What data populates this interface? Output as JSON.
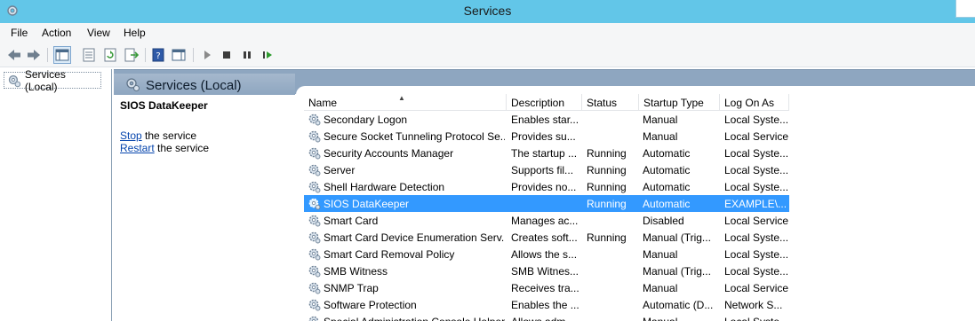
{
  "window": {
    "title": "Services",
    "app_icon": "gear-icon"
  },
  "menu": {
    "file": "File",
    "action": "Action",
    "view": "View",
    "help": "Help"
  },
  "toolbar": {
    "buttons": [
      "back-arrow-icon",
      "forward-arrow-icon",
      "show-hide-tree-icon",
      "properties-icon",
      "refresh-icon",
      "export-list-icon",
      "help-icon",
      "show-action-pane-icon",
      "play-icon",
      "stop-icon",
      "pause-icon",
      "resume-icon"
    ]
  },
  "tree": {
    "root_label": "Services (Local)"
  },
  "header": {
    "title": "Services (Local)"
  },
  "details": {
    "service_name": "SIOS DataKeeper",
    "stop_link": "Stop",
    "stop_rest": " the service",
    "restart_link": "Restart",
    "restart_rest": " the service"
  },
  "table": {
    "columns": [
      "Name",
      "Description",
      "Status",
      "Startup Type",
      "Log On As"
    ],
    "sorted_by": "Name",
    "rows": [
      {
        "name": "Secondary Logon",
        "description": "Enables star...",
        "status": "",
        "startup": "Manual",
        "logon": "Local Syste..."
      },
      {
        "name": "Secure Socket Tunneling Protocol Se...",
        "description": "Provides su...",
        "status": "",
        "startup": "Manual",
        "logon": "Local Service"
      },
      {
        "name": "Security Accounts Manager",
        "description": "The startup ...",
        "status": "Running",
        "startup": "Automatic",
        "logon": "Local Syste..."
      },
      {
        "name": "Server",
        "description": "Supports fil...",
        "status": "Running",
        "startup": "Automatic",
        "logon": "Local Syste..."
      },
      {
        "name": "Shell Hardware Detection",
        "description": "Provides no...",
        "status": "Running",
        "startup": "Automatic",
        "logon": "Local Syste..."
      },
      {
        "name": "SIOS DataKeeper",
        "description": "",
        "status": "Running",
        "startup": "Automatic",
        "logon": "EXAMPLE\\...",
        "selected": true
      },
      {
        "name": "Smart Card",
        "description": "Manages ac...",
        "status": "",
        "startup": "Disabled",
        "logon": "Local Service"
      },
      {
        "name": "Smart Card Device Enumeration Serv...",
        "description": "Creates soft...",
        "status": "Running",
        "startup": "Manual (Trig...",
        "logon": "Local Syste..."
      },
      {
        "name": "Smart Card Removal Policy",
        "description": "Allows the s...",
        "status": "",
        "startup": "Manual",
        "logon": "Local Syste..."
      },
      {
        "name": "SMB Witness",
        "description": "SMB Witnes...",
        "status": "",
        "startup": "Manual (Trig...",
        "logon": "Local Syste..."
      },
      {
        "name": "SNMP Trap",
        "description": "Receives tra...",
        "status": "",
        "startup": "Manual",
        "logon": "Local Service"
      },
      {
        "name": "Software Protection",
        "description": "Enables the ...",
        "status": "",
        "startup": "Automatic (D...",
        "logon": "Network S..."
      },
      {
        "name": "Special Administration Console Helper",
        "description": "Allows adm...",
        "status": "",
        "startup": "Manual",
        "logon": "Local Syste..."
      }
    ]
  },
  "colors": {
    "titlebar": "#62c6e8",
    "selection": "#3399ff",
    "header_band": "#8ea6c0",
    "link": "#0645ad"
  }
}
